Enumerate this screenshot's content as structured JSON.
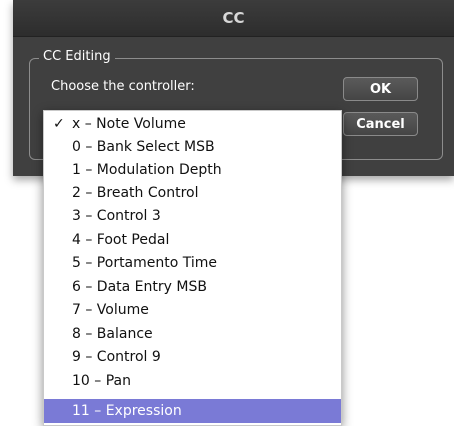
{
  "window": {
    "title": "CC"
  },
  "group": {
    "title": "CC Editing",
    "prompt": "Choose the controller:"
  },
  "buttons": {
    "ok": "OK",
    "cancel": "Cancel"
  },
  "dropdown": {
    "check_glyph": "✓",
    "items": [
      {
        "label": "x – Note Volume",
        "checked": true,
        "highlighted": false
      },
      {
        "label": "0 – Bank Select MSB",
        "checked": false,
        "highlighted": false
      },
      {
        "label": "1 – Modulation Depth",
        "checked": false,
        "highlighted": false
      },
      {
        "label": "2 – Breath Control",
        "checked": false,
        "highlighted": false
      },
      {
        "label": "3 – Control 3",
        "checked": false,
        "highlighted": false
      },
      {
        "label": "4 – Foot Pedal",
        "checked": false,
        "highlighted": false
      },
      {
        "label": "5 – Portamento Time",
        "checked": false,
        "highlighted": false
      },
      {
        "label": "6 – Data Entry MSB",
        "checked": false,
        "highlighted": false
      },
      {
        "label": "7 – Volume",
        "checked": false,
        "highlighted": false
      },
      {
        "label": "8 – Balance",
        "checked": false,
        "highlighted": false
      },
      {
        "label": "9 – Control 9",
        "checked": false,
        "highlighted": false
      },
      {
        "label": "10 – Pan",
        "checked": false,
        "highlighted": false
      },
      {
        "label": "11 – Expression",
        "checked": false,
        "highlighted": true
      }
    ]
  },
  "colors": {
    "dialog_bg": "#404040",
    "title_bar": "#2d2d2d",
    "highlight": "#7a7ad6"
  }
}
